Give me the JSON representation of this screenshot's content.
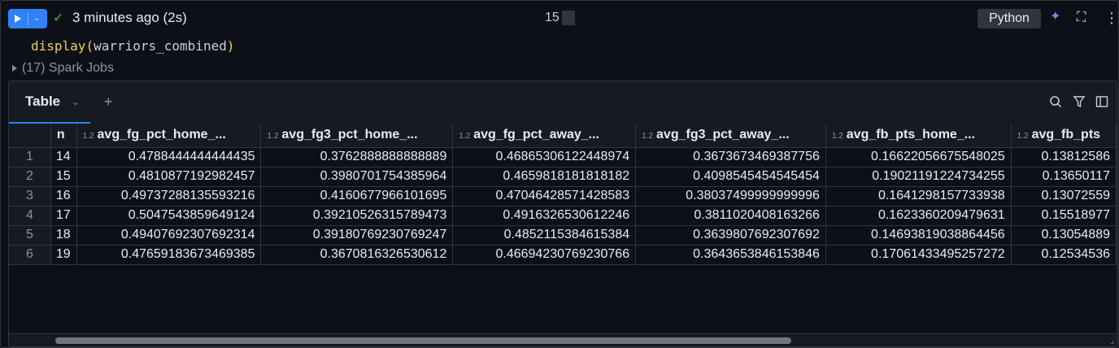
{
  "cell": {
    "status": "3 minutes ago (2s)",
    "center_label": "15",
    "language": "Python",
    "code": {
      "fn": "display",
      "open": "(",
      "arg": "warriors_combined",
      "close": ")"
    },
    "spark_jobs": "(17) Spark Jobs"
  },
  "icons": {
    "run": "play-icon",
    "run_menu": "chevron-down-icon",
    "status": "check-icon",
    "assistant": "sparkle-icon",
    "expand": "expand-icon",
    "more": "more-vertical-icon",
    "search": "search-icon",
    "filter": "filter-icon",
    "panel": "panel-icon",
    "jobs_toggle": "caret-right-icon"
  },
  "output": {
    "tab_label": "Table",
    "add_tab": "+"
  },
  "table": {
    "columns": [
      {
        "type": "",
        "label": "n"
      },
      {
        "type": "1.2",
        "label": "avg_fg_pct_home_..."
      },
      {
        "type": "1.2",
        "label": "avg_fg3_pct_home_..."
      },
      {
        "type": "1.2",
        "label": "avg_fg_pct_away_..."
      },
      {
        "type": "1.2",
        "label": "avg_fg3_pct_away_..."
      },
      {
        "type": "1.2",
        "label": "avg_fb_pts_home_..."
      },
      {
        "type": "1.2",
        "label": "avg_fb_pts"
      }
    ],
    "rows": [
      {
        "idx": "1",
        "cells": [
          "14",
          "0.4788444444444435",
          "0.3762888888888889",
          "0.46865306122448974",
          "0.3673673469387756",
          "0.16622056675548025",
          "0.13812586"
        ]
      },
      {
        "idx": "2",
        "cells": [
          "15",
          "0.4810877192982457",
          "0.3980701754385964",
          "0.4659818181818182",
          "0.4098545454545454",
          "0.19021191224734255",
          "0.13650117"
        ]
      },
      {
        "idx": "3",
        "cells": [
          "16",
          "0.49737288135593216",
          "0.4160677966101695",
          "0.47046428571428583",
          "0.38037499999999996",
          "0.1641298157733938",
          "0.13072559"
        ]
      },
      {
        "idx": "4",
        "cells": [
          "17",
          "0.5047543859649124",
          "0.39210526315789473",
          "0.4916326530612246",
          "0.3811020408163266",
          "0.1623360209479631",
          "0.15518977"
        ]
      },
      {
        "idx": "5",
        "cells": [
          "18",
          "0.49407692307692314",
          "0.39180769230769247",
          "0.4852115384615384",
          "0.3639807692307692",
          "0.14693819038864456",
          "0.13054889"
        ]
      },
      {
        "idx": "6",
        "cells": [
          "19",
          "0.47659183673469385",
          "0.3670816326530612",
          "0.46694230769230766",
          "0.3643653846153846",
          "0.17061433495257272",
          "0.12534536"
        ]
      }
    ]
  }
}
